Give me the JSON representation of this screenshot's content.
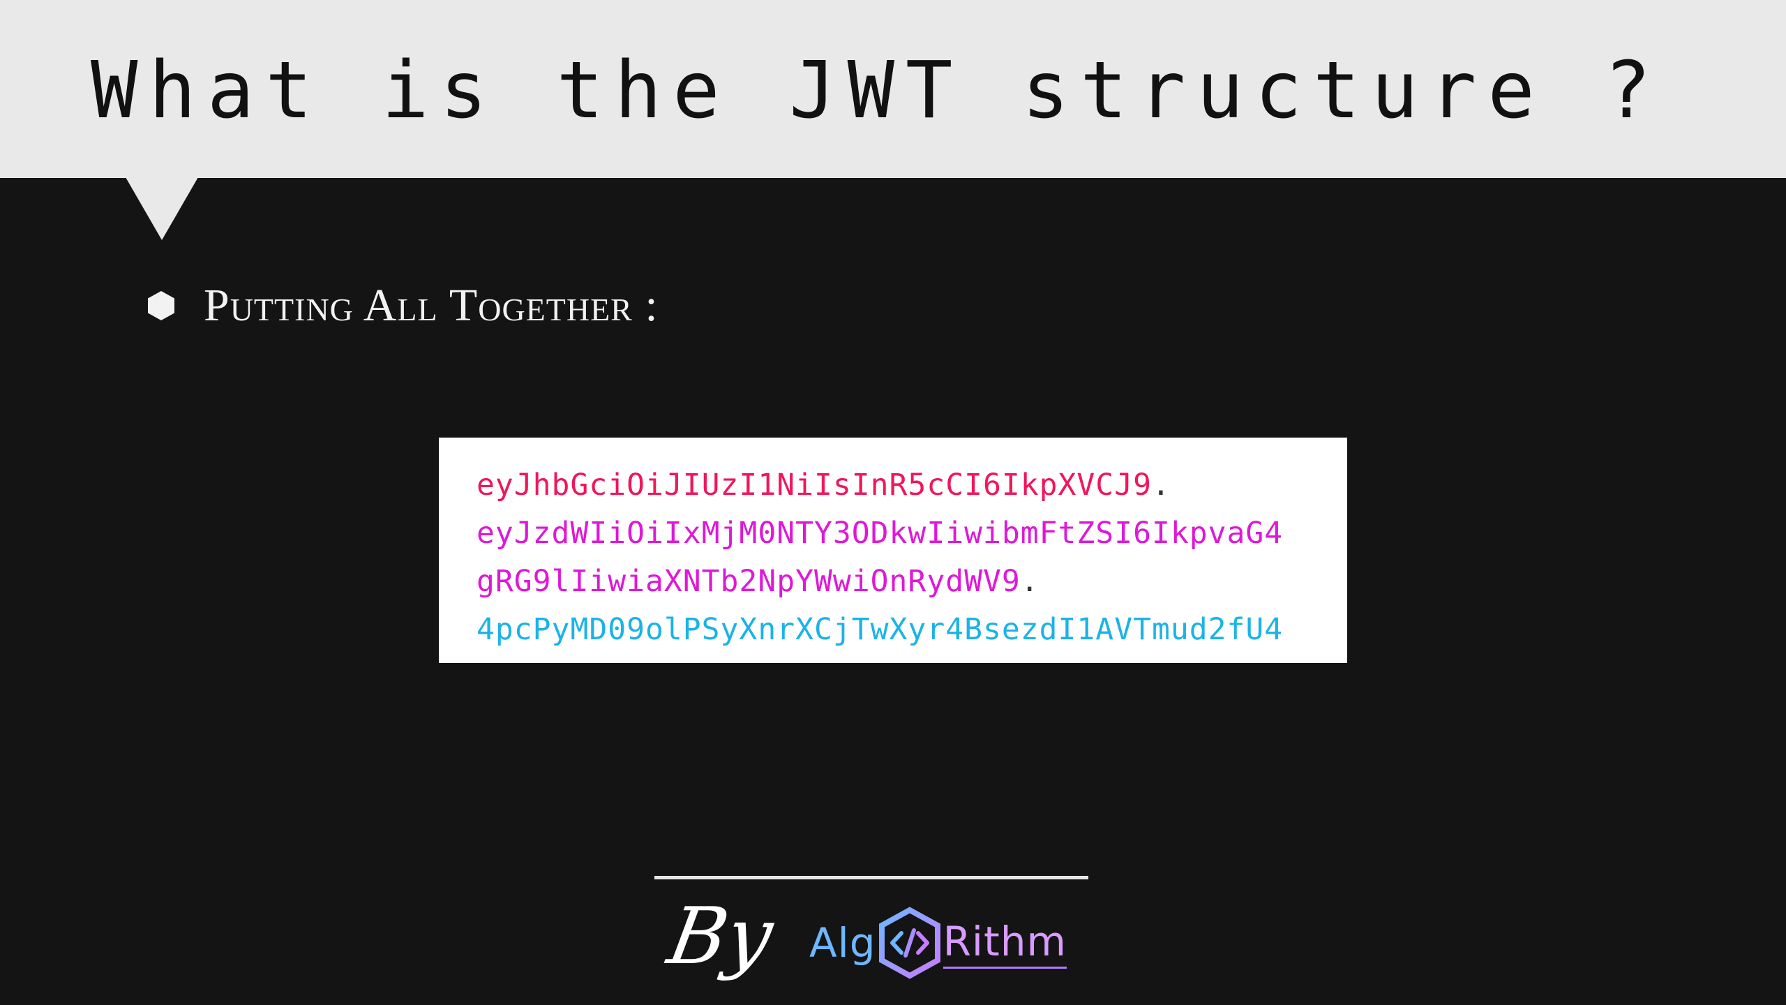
{
  "header": {
    "title": "What is the JWT structure ?"
  },
  "bullet": {
    "icon": "hexagon-bullet-icon",
    "text": "Putting All Together :"
  },
  "token": {
    "colors": {
      "header": "#f0165a",
      "payload": "#de18d8",
      "signature": "#1ab3e8",
      "separator": "#333333"
    },
    "lines": [
      {
        "text": "eyJhbGciOiJIUzI1NiIsInR5cCI6IkpXVCJ9",
        "separator": ".",
        "part": "header"
      },
      {
        "text": "eyJzdWIiOiIxMjM0NTY3ODkwIiwibmFtZSI6IkpvaG4",
        "separator": "",
        "part": "payload"
      },
      {
        "text": "gRG9lIiwiaXNTb2NpYWwiOnRydWV9",
        "separator": ".",
        "part": "payload"
      },
      {
        "text": "4pcPyMD09olPSyXnrXCjTwXyr4BsezdI1AVTmud2fU4",
        "separator": "",
        "part": "signature"
      }
    ]
  },
  "footer": {
    "by": "By",
    "brand_left": "Alg",
    "brand_icon": "code-hexagon-icon",
    "brand_right": "Rithm",
    "colors": {
      "left": "#6fb6ff",
      "right": "#d89cff"
    }
  }
}
